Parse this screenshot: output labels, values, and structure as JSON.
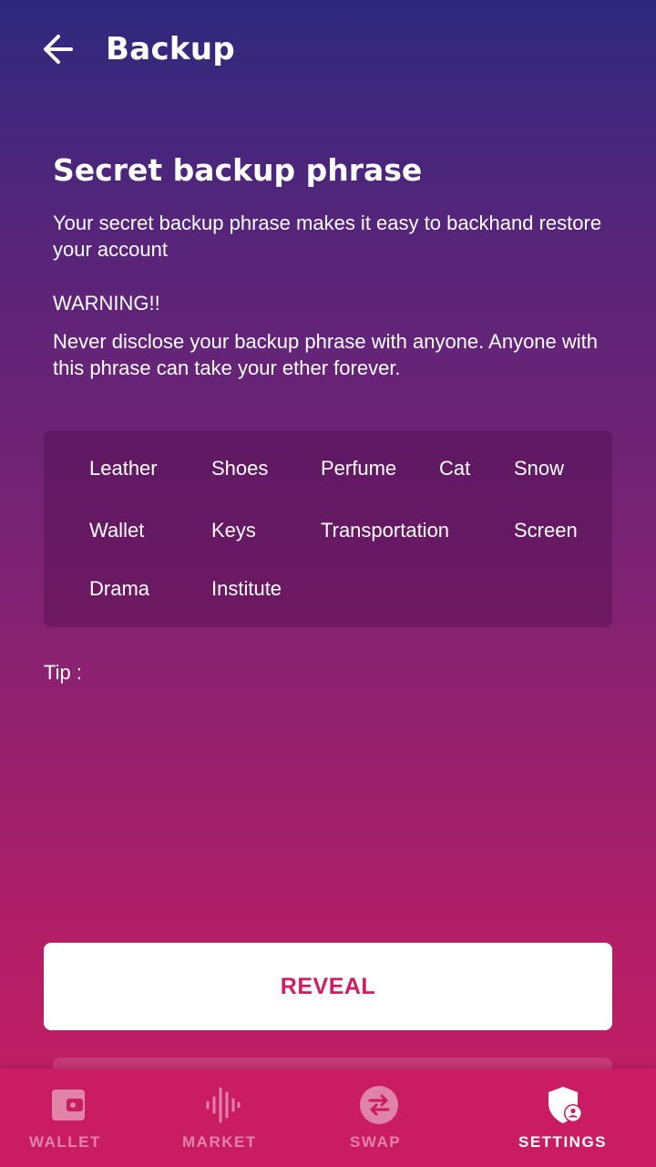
{
  "header": {
    "title": "Backup",
    "back_icon": "arrow-left-icon"
  },
  "intro": {
    "title": "Secret backup phrase",
    "description": "Your secret backup phrase makes it easy to backhand restore your account",
    "warning_title": "WARNING!!",
    "warning_text": "Never disclose your backup phrase with anyone. Anyone with this phrase can take your ether forever."
  },
  "phrase": {
    "words": [
      "Leather",
      "Shoes",
      "Perfume",
      "Cat",
      "Snow",
      "Wallet",
      "Keys",
      "Transportation",
      "Screen",
      "Drama",
      "Institute"
    ]
  },
  "tip": {
    "label": "Tip :"
  },
  "actions": {
    "reveal_label": "REVEAL"
  },
  "bottom_nav": {
    "items": [
      {
        "label": "WALLET",
        "icon": "wallet-icon",
        "active": false
      },
      {
        "label": "MARKET",
        "icon": "market-waveform-icon",
        "active": false
      },
      {
        "label": "SWAP",
        "icon": "swap-icon",
        "active": false
      },
      {
        "label": "SETTINGS",
        "icon": "shield-user-icon",
        "active": true
      }
    ]
  },
  "colors": {
    "gradient_top": "#2e297d",
    "gradient_bottom": "#c91c62",
    "accent": "#d11b62",
    "nav_background": "#c91c62"
  }
}
